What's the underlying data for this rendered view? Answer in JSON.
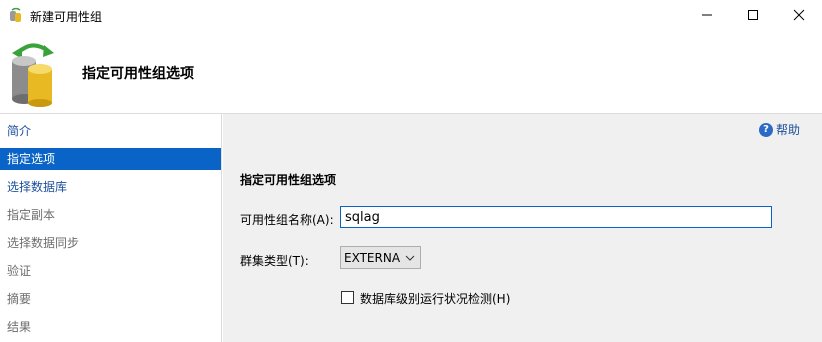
{
  "window": {
    "title": "新建可用性组",
    "controls": {
      "minimize": "minimize",
      "maximize": "maximize",
      "close": "close"
    }
  },
  "header": {
    "title": "指定可用性组选项",
    "icon": "availability-group-database-icon"
  },
  "sidebar": {
    "items": [
      {
        "label": "简介",
        "state": "link"
      },
      {
        "label": "指定选项",
        "state": "selected"
      },
      {
        "label": "选择数据库",
        "state": "link"
      },
      {
        "label": "指定副本",
        "state": "disabled"
      },
      {
        "label": "选择数据同步",
        "state": "disabled"
      },
      {
        "label": "验证",
        "state": "disabled"
      },
      {
        "label": "摘要",
        "state": "disabled"
      },
      {
        "label": "结果",
        "state": "disabled"
      }
    ]
  },
  "main": {
    "help_label": "帮助",
    "section_title": "指定可用性组选项",
    "group_name_label": "可用性组名称(A):",
    "group_name_value": "sqlag",
    "cluster_type_label": "群集类型(T):",
    "cluster_type_value": "EXTERNAL",
    "health_check_label": "数据库级别运行状况检测(H)",
    "health_check_checked": false
  },
  "colors": {
    "selected_bg": "#0a64c8",
    "link_text": "#1b4f9c",
    "disabled_text": "#6d6d6d",
    "panel_bg": "#f0f0f0"
  }
}
